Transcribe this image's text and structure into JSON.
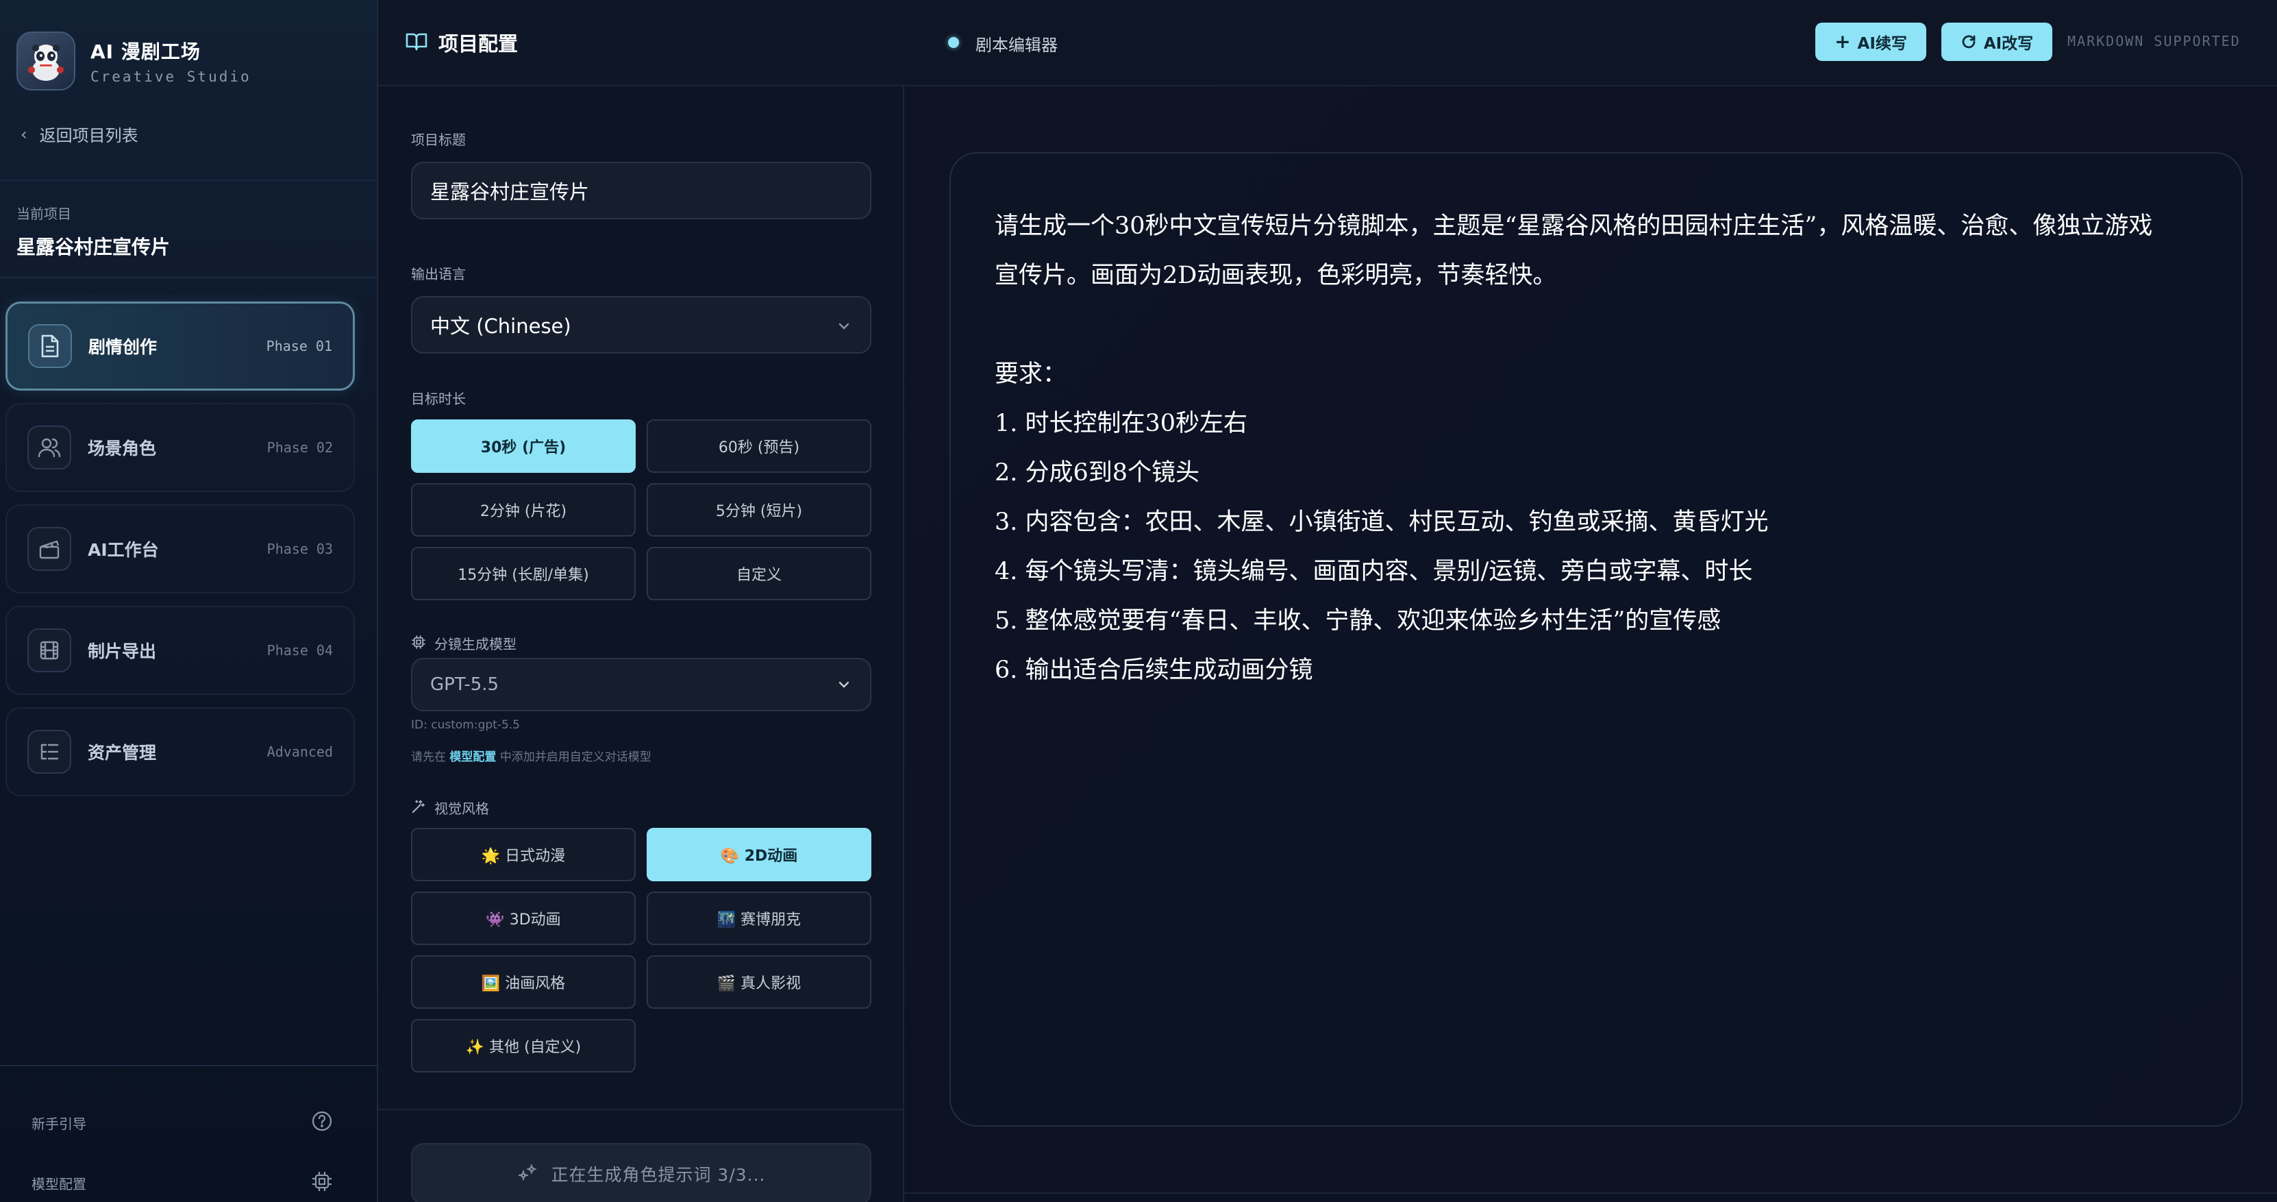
{
  "brand": {
    "title": "AI 漫剧工场",
    "subtitle": "Creative Studio"
  },
  "sidebar": {
    "back_label": "返回项目列表",
    "current_caption": "当前项目",
    "current_name": "星露谷村庄宣传片",
    "items": [
      {
        "label": "剧情创作",
        "phase": "Phase 01",
        "icon": "document-icon",
        "active": true
      },
      {
        "label": "场景角色",
        "phase": "Phase 02",
        "icon": "users-icon",
        "active": false
      },
      {
        "label": "AI工作台",
        "phase": "Phase 03",
        "icon": "clapperboard-icon",
        "active": false
      },
      {
        "label": "制片导出",
        "phase": "Phase 04",
        "icon": "film-icon",
        "active": false
      },
      {
        "label": "资产管理",
        "phase": "Advanced",
        "icon": "list-icon",
        "active": false
      }
    ],
    "footer": {
      "guide_label": "新手引导",
      "model_config_label": "模型配置"
    }
  },
  "config": {
    "header_title": "项目配置",
    "title_label": "项目标题",
    "title_value": "星露谷村庄宣传片",
    "language_label": "输出语言",
    "language_value": "中文 (Chinese)",
    "duration_label": "目标时长",
    "durations": [
      "30秒 (广告)",
      "60秒 (预告)",
      "2分钟 (片花)",
      "5分钟 (短片)",
      "15分钟 (长剧/单集)",
      "自定义"
    ],
    "duration_selected": "30秒 (广告)",
    "model_label": "分镜生成模型",
    "model_value": "GPT-5.5",
    "model_id": "ID: custom:gpt-5.5",
    "model_hint_prefix": "请先在",
    "model_hint_link": "模型配置",
    "model_hint_suffix": "中添加并启用自定义对话模型",
    "style_label": "视觉风格",
    "styles": [
      "🌟 日式动漫",
      "🎨 2D动画",
      "👾 3D动画",
      "🌃 赛博朋克",
      "🖼️ 油画风格",
      "🎬 真人影视",
      "✨ 其他 (自定义)"
    ],
    "style_selected": "🎨 2D动画",
    "generate_label": "正在生成角色提示词 3/3..."
  },
  "editor": {
    "title": "剧本编辑器",
    "continue_label": "AI续写",
    "rewrite_label": "AI改写",
    "markdown_note": "MARKDOWN SUPPORTED",
    "content": {
      "intro_1": "请生成一个30秒中文宣传短片分镜脚本，主题是“星露谷风格的田园村庄生活”，风格温暖、治愈、像独立游戏",
      "intro_2": "宣传片。画面为2D动画表现，色彩明亮，节奏轻快。",
      "req_title": "要求：",
      "req_1": "1. 时长控制在30秒左右",
      "req_2": "2. 分成6到8个镜头",
      "req_3": "3. 内容包含：农田、木屋、小镇街道、村民互动、钓鱼或采摘、黄昏灯光",
      "req_4": "4. 每个镜头写清：镜头编号、画面内容、景别/运镜、旁白或字幕、时长",
      "req_5": "5. 整体感觉要有“春日、丰收、宁静、欢迎来体验乡村生活”的宣传感",
      "req_6": "6. 输出适合后续生成动画分镜"
    }
  },
  "colors": {
    "accent": "#8ee3f7",
    "background": "#0b1020",
    "panel": "#0d1424"
  }
}
